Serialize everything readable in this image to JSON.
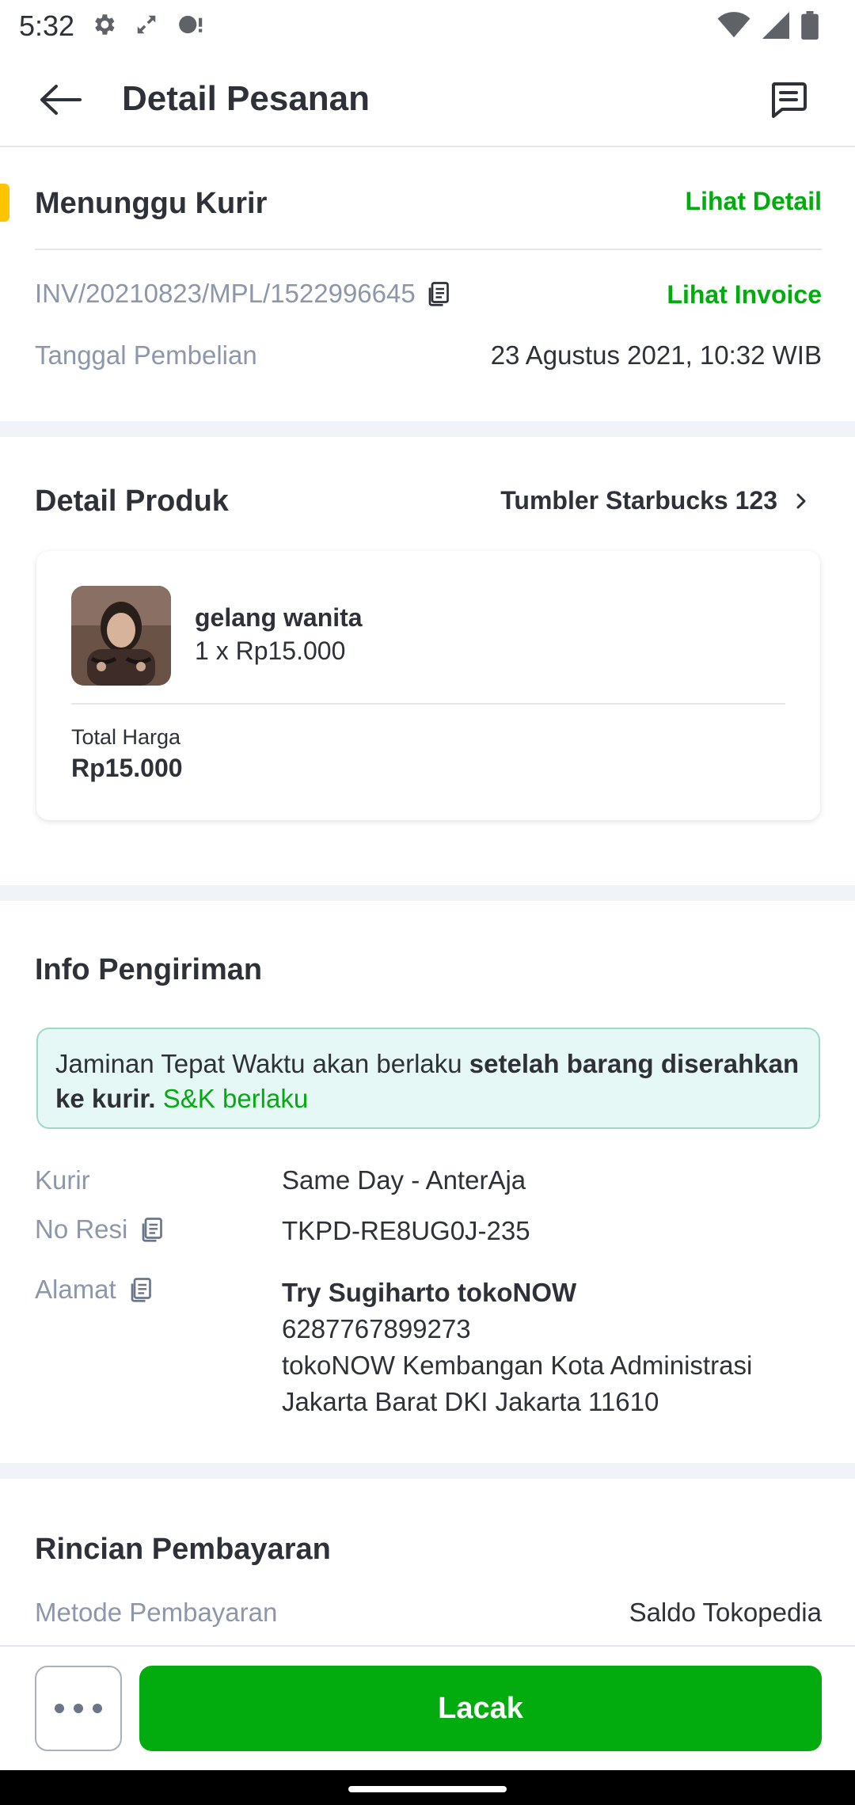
{
  "status_bar": {
    "time": "5:32"
  },
  "header": {
    "title": "Detail Pesanan"
  },
  "order_status": {
    "label": "Menunggu Kurir",
    "detail_link": "Lihat Detail",
    "invoice_number": "INV/20210823/MPL/1522996645",
    "invoice_link": "Lihat Invoice",
    "purchase_date_label": "Tanggal Pembelian",
    "purchase_date_value": "23 Agustus 2021, 10:32 WIB"
  },
  "product": {
    "section_title": "Detail Produk",
    "shop_name": "Tumbler Starbucks 123",
    "name": "gelang wanita",
    "qty_price": "1 x Rp15.000",
    "total_label": "Total Harga",
    "total_value": "Rp15.000"
  },
  "shipping": {
    "section_title": "Info Pengiriman",
    "notice_plain": "Jaminan Tepat Waktu akan berlaku ",
    "notice_bold": "setelah barang diserahkan ke kurir.",
    "notice_link": "S&K berlaku",
    "courier_label": "Kurir",
    "courier_value": "Same Day - AnterAja",
    "resi_label": "No Resi",
    "resi_value": "TKPD-RE8UG0J-235",
    "address_label": "Alamat",
    "address_name": "Try Sugiharto tokoNOW",
    "address_phone": "6287767899273",
    "address_line1": "tokoNOW Kembangan Kota Administrasi",
    "address_line2": "Jakarta Barat DKI Jakarta 11610"
  },
  "payment": {
    "section_title": "Rincian Pembayaran",
    "method_label": "Metode Pembayaran",
    "method_value": "Saldo Tokopedia"
  },
  "bottom_bar": {
    "primary_label": "Lacak"
  },
  "colors": {
    "accent": "#03ac0e",
    "status_accent": "#ffc400",
    "muted": "#8d96aa"
  }
}
